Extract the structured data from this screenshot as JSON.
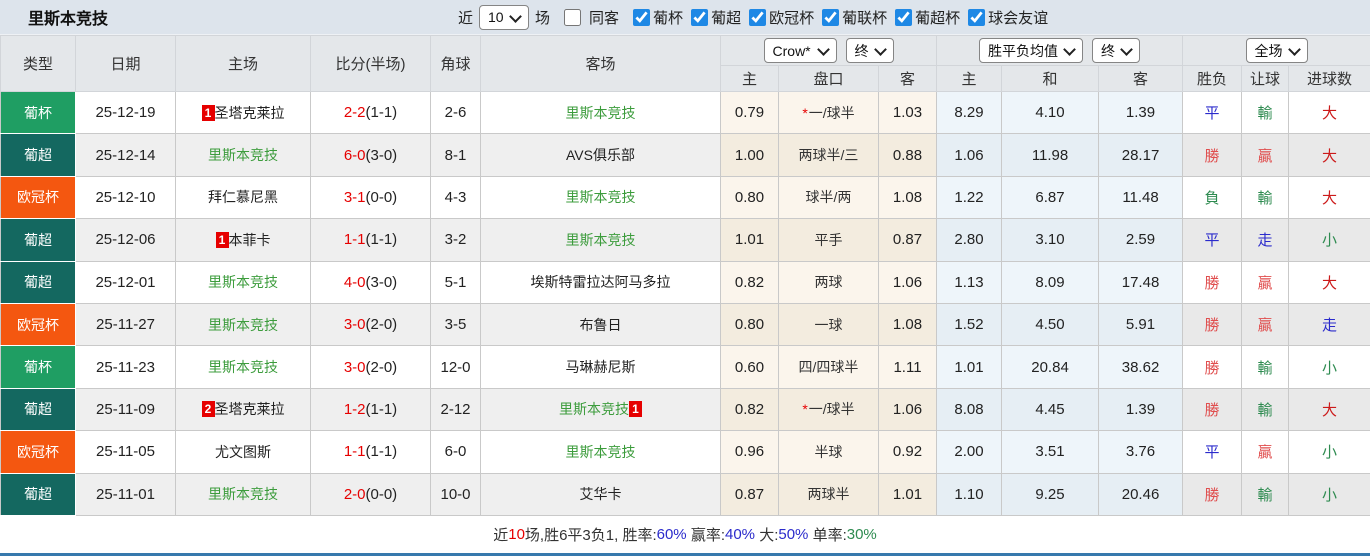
{
  "colors": {
    "cup": "#1f9e63",
    "league": "#146860",
    "ucl": "#f45710",
    "focus": "#3c9c3c",
    "score": "#e60000",
    "win": "#e04e4e",
    "red": "#cc1a1a",
    "green": "#2e8b50",
    "blue": "#2b2bcc",
    "text": "#333333",
    "checkbox_accent": "#1e88e5",
    "bottom_bar": "#3779ad"
  },
  "topbar": {
    "title": "里斯本竞技",
    "recent_prefix": "近",
    "recent_value": "10",
    "recent_suffix": "场",
    "same_venue_label": "同客",
    "same_venue_checked": false,
    "competitions": [
      {
        "label": "葡杯",
        "checked": true
      },
      {
        "label": "葡超",
        "checked": true
      },
      {
        "label": "欧冠杯",
        "checked": true
      },
      {
        "label": "葡联杯",
        "checked": true
      },
      {
        "label": "葡超杯",
        "checked": true
      },
      {
        "label": "球会友谊",
        "checked": true
      }
    ]
  },
  "header": {
    "cols": [
      "类型",
      "日期",
      "主场",
      "比分(半场)",
      "角球",
      "客场"
    ],
    "ah_book_select": "Crow*",
    "ah_time_select": "终",
    "eu_type_select": "胜平负均值",
    "eu_time_select": "终",
    "scope_select": "全场",
    "sub": [
      "主",
      "盘口",
      "客",
      "主",
      "和",
      "客",
      "胜负",
      "让球",
      "进球数"
    ]
  },
  "rows": [
    {
      "type": "葡杯",
      "type_key": "cup",
      "date": "25-12-19",
      "home": {
        "name": "圣塔克莱拉",
        "badge": "1",
        "badge_pos": "before",
        "focus": false
      },
      "score_main": "2-2",
      "score_half": "(1-1)",
      "corners": "2-6",
      "away": {
        "name": "里斯本竞技",
        "focus": true
      },
      "ah_home": "0.79",
      "ah_star": true,
      "ah_line": "一/球半",
      "ah_away": "1.03",
      "eu_home": "8.29",
      "eu_draw": "4.10",
      "eu_away": "1.39",
      "res": [
        [
          "平",
          "blue"
        ],
        [
          "輸",
          "green"
        ],
        [
          "大",
          "red"
        ]
      ]
    },
    {
      "type": "葡超",
      "type_key": "league",
      "date": "25-12-14",
      "home": {
        "name": "里斯本竞技",
        "focus": true
      },
      "score_main": "6-0",
      "score_half": "(3-0)",
      "corners": "8-1",
      "away": {
        "name": "AVS俱乐部",
        "focus": false
      },
      "ah_home": "1.00",
      "ah_star": false,
      "ah_line": "两球半/三",
      "ah_away": "0.88",
      "eu_home": "1.06",
      "eu_draw": "11.98",
      "eu_away": "28.17",
      "res": [
        [
          "勝",
          "win"
        ],
        [
          "贏",
          "win"
        ],
        [
          "大",
          "red"
        ]
      ]
    },
    {
      "type": "欧冠杯",
      "type_key": "ucl",
      "date": "25-12-10",
      "home": {
        "name": "拜仁慕尼黑",
        "focus": false
      },
      "score_main": "3-1",
      "score_half": "(0-0)",
      "corners": "4-3",
      "away": {
        "name": "里斯本竞技",
        "focus": true
      },
      "ah_home": "0.80",
      "ah_star": false,
      "ah_line": "球半/两",
      "ah_away": "1.08",
      "eu_home": "1.22",
      "eu_draw": "6.87",
      "eu_away": "11.48",
      "res": [
        [
          "負",
          "green"
        ],
        [
          "輸",
          "green"
        ],
        [
          "大",
          "red"
        ]
      ]
    },
    {
      "type": "葡超",
      "type_key": "league",
      "date": "25-12-06",
      "home": {
        "name": "本菲卡",
        "badge": "1",
        "badge_pos": "before",
        "focus": false
      },
      "score_main": "1-1",
      "score_half": "(1-1)",
      "corners": "3-2",
      "away": {
        "name": "里斯本竞技",
        "focus": true
      },
      "ah_home": "1.01",
      "ah_star": false,
      "ah_line": "平手",
      "ah_away": "0.87",
      "eu_home": "2.80",
      "eu_draw": "3.10",
      "eu_away": "2.59",
      "res": [
        [
          "平",
          "blue"
        ],
        [
          "走",
          "blue"
        ],
        [
          "小",
          "green"
        ]
      ]
    },
    {
      "type": "葡超",
      "type_key": "league",
      "date": "25-12-01",
      "home": {
        "name": "里斯本竞技",
        "focus": true
      },
      "score_main": "4-0",
      "score_half": "(3-0)",
      "corners": "5-1",
      "away": {
        "name": "埃斯特雷拉达阿马多拉",
        "focus": false
      },
      "ah_home": "0.82",
      "ah_star": false,
      "ah_line": "两球",
      "ah_away": "1.06",
      "eu_home": "1.13",
      "eu_draw": "8.09",
      "eu_away": "17.48",
      "res": [
        [
          "勝",
          "win"
        ],
        [
          "贏",
          "win"
        ],
        [
          "大",
          "red"
        ]
      ]
    },
    {
      "type": "欧冠杯",
      "type_key": "ucl",
      "date": "25-11-27",
      "home": {
        "name": "里斯本竞技",
        "focus": true
      },
      "score_main": "3-0",
      "score_half": "(2-0)",
      "corners": "3-5",
      "away": {
        "name": "布鲁日",
        "focus": false
      },
      "ah_home": "0.80",
      "ah_star": false,
      "ah_line": "一球",
      "ah_away": "1.08",
      "eu_home": "1.52",
      "eu_draw": "4.50",
      "eu_away": "5.91",
      "res": [
        [
          "勝",
          "win"
        ],
        [
          "贏",
          "win"
        ],
        [
          "走",
          "blue"
        ]
      ]
    },
    {
      "type": "葡杯",
      "type_key": "cup",
      "date": "25-11-23",
      "home": {
        "name": "里斯本竞技",
        "focus": true
      },
      "score_main": "3-0",
      "score_half": "(2-0)",
      "corners": "12-0",
      "away": {
        "name": "马琳赫尼斯",
        "focus": false
      },
      "ah_home": "0.60",
      "ah_star": false,
      "ah_line": "四/四球半",
      "ah_away": "1.11",
      "eu_home": "1.01",
      "eu_draw": "20.84",
      "eu_away": "38.62",
      "res": [
        [
          "勝",
          "win"
        ],
        [
          "輸",
          "green"
        ],
        [
          "小",
          "green"
        ]
      ]
    },
    {
      "type": "葡超",
      "type_key": "league",
      "date": "25-11-09",
      "home": {
        "name": "圣塔克莱拉",
        "badge": "2",
        "badge_pos": "before",
        "focus": false
      },
      "score_main": "1-2",
      "score_half": "(1-1)",
      "corners": "2-12",
      "away": {
        "name": "里斯本竞技",
        "badge": "1",
        "badge_pos": "after",
        "focus": true
      },
      "ah_home": "0.82",
      "ah_star": true,
      "ah_line": "一/球半",
      "ah_away": "1.06",
      "eu_home": "8.08",
      "eu_draw": "4.45",
      "eu_away": "1.39",
      "res": [
        [
          "勝",
          "win"
        ],
        [
          "輸",
          "green"
        ],
        [
          "大",
          "red"
        ]
      ]
    },
    {
      "type": "欧冠杯",
      "type_key": "ucl",
      "date": "25-11-05",
      "home": {
        "name": "尤文图斯",
        "focus": false
      },
      "score_main": "1-1",
      "score_half": "(1-1)",
      "corners": "6-0",
      "away": {
        "name": "里斯本竞技",
        "focus": true
      },
      "ah_home": "0.96",
      "ah_star": false,
      "ah_line": "半球",
      "ah_away": "0.92",
      "eu_home": "2.00",
      "eu_draw": "3.51",
      "eu_away": "3.76",
      "res": [
        [
          "平",
          "blue"
        ],
        [
          "贏",
          "win"
        ],
        [
          "小",
          "green"
        ]
      ]
    },
    {
      "type": "葡超",
      "type_key": "league",
      "date": "25-11-01",
      "home": {
        "name": "里斯本竞技",
        "focus": true
      },
      "score_main": "2-0",
      "score_half": "(0-0)",
      "corners": "10-0",
      "away": {
        "name": "艾华卡",
        "focus": false
      },
      "ah_home": "0.87",
      "ah_star": false,
      "ah_line": "两球半",
      "ah_away": "1.01",
      "eu_home": "1.10",
      "eu_draw": "9.25",
      "eu_away": "20.46",
      "res": [
        [
          "勝",
          "win"
        ],
        [
          "輸",
          "green"
        ],
        [
          "小",
          "green"
        ]
      ]
    }
  ],
  "footer": {
    "segments": [
      [
        "近",
        "text"
      ],
      [
        "10",
        "score"
      ],
      [
        "场,胜6平3负1, 胜率:",
        "text"
      ],
      [
        "60%",
        "blue"
      ],
      [
        " 赢率:",
        "text"
      ],
      [
        "40%",
        "blue"
      ],
      [
        " 大:",
        "text"
      ],
      [
        "50%",
        "blue"
      ],
      [
        " 单率:",
        "text"
      ],
      [
        "30%",
        "green"
      ]
    ]
  }
}
